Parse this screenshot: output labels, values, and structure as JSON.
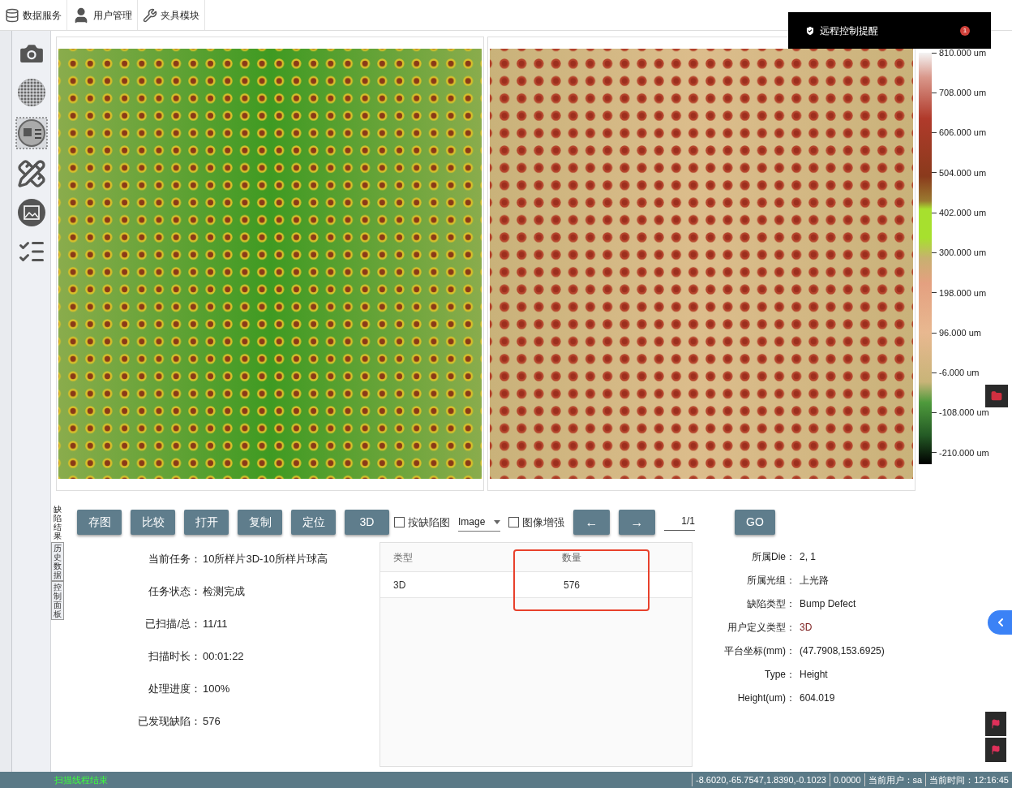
{
  "toolbar": [
    {
      "label": "数据服务"
    },
    {
      "label": "用户管理"
    },
    {
      "label": "夹具模块"
    }
  ],
  "notification": {
    "title": "远程控制提醒",
    "count": "1"
  },
  "colorbar": {
    "ticks": [
      "810.000 um",
      "708.000 um",
      "606.000 um",
      "504.000 um",
      "402.000 um",
      "300.000 um",
      "198.000 um",
      "96.000 um",
      "-6.000 um",
      "-108.000 um",
      "-210.000 um"
    ]
  },
  "side_tabs": [
    {
      "label": "缺陷结果",
      "selected": true
    },
    {
      "label": "历史数据",
      "selected": false
    },
    {
      "label": "控制面板",
      "selected": false
    }
  ],
  "controls": {
    "buttons": [
      "存图",
      "比较",
      "打开",
      "复制",
      "定位",
      "3D"
    ],
    "defect_map_checkbox": {
      "label": "按缺陷图",
      "checked": false
    },
    "view_select": {
      "value": "Image"
    },
    "enhance_checkbox": {
      "label": "图像增强",
      "checked": false
    },
    "prev_button": "←",
    "next_button": "→",
    "page": "1/1",
    "go_button": "GO"
  },
  "task_info": [
    {
      "label": "当前任务：",
      "value": "10所样片3D-10所样片球高"
    },
    {
      "label": "任务状态：",
      "value": "检测完成"
    },
    {
      "label": "已扫描/总：",
      "value": "11/11"
    },
    {
      "label": "扫描时长：",
      "value": "00:01:22"
    },
    {
      "label": "处理进度：",
      "value": "100%"
    },
    {
      "label": "已发现缺陷：",
      "value": "576"
    }
  ],
  "defect_table": {
    "columns": [
      "类型",
      "数量"
    ],
    "rows": [
      [
        "3D",
        "576"
      ]
    ]
  },
  "defect_info": [
    {
      "label": "所属Die：",
      "value": "2, 1",
      "highlighted": false
    },
    {
      "label": "所属光组：",
      "value": "上光路",
      "highlighted": false
    },
    {
      "label": "缺陷类型：",
      "value": "Bump Defect",
      "highlighted": false
    },
    {
      "label": "用户定义类型：",
      "value": "3D",
      "highlighted": true
    },
    {
      "label": "平台坐标(mm)：",
      "value": "(47.7908,153.6925)",
      "highlighted": false
    },
    {
      "label": "Type：",
      "value": "Height",
      "highlighted": false
    },
    {
      "label": "Height(um)：",
      "value": "604.019",
      "highlighted": false
    }
  ],
  "status_bar": {
    "message": "扫描线程结束",
    "coordinates": "-8.6020,-65.7547,1.8390,-0.1023",
    "value": "0.0000",
    "user": "当前用户：sa",
    "time": "当前时间：12:16:45"
  }
}
